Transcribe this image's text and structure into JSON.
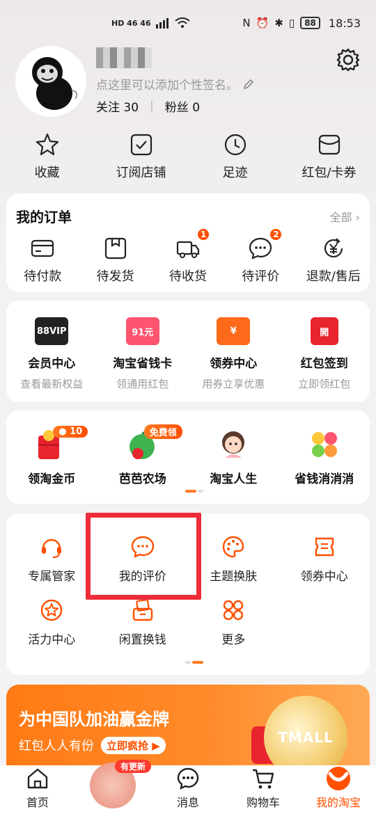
{
  "status_bar": {
    "network": "HD 46 46",
    "battery": "88",
    "time": "18:53"
  },
  "profile": {
    "signature_placeholder": "点这里可以添加个性签名。",
    "following_label": "关注",
    "following_count": "30",
    "followers_label": "粉丝",
    "followers_count": "0"
  },
  "quick_links": [
    {
      "label": "收藏",
      "icon": "star-icon"
    },
    {
      "label": "订阅店铺",
      "icon": "subscribe-icon"
    },
    {
      "label": "足迹",
      "icon": "clock-icon"
    },
    {
      "label": "红包/卡券",
      "icon": "coupon-icon"
    }
  ],
  "orders": {
    "title": "我的订单",
    "all_label": "全部 ›",
    "items": [
      {
        "label": "待付款",
        "badge": ""
      },
      {
        "label": "待发货",
        "badge": ""
      },
      {
        "label": "待收货",
        "badge": "1"
      },
      {
        "label": "待评价",
        "badge": "2"
      },
      {
        "label": "退款/售后",
        "badge": ""
      }
    ]
  },
  "vip_services": [
    {
      "icon_text": "88VIP",
      "title": "会员中心",
      "sub": "查看最新权益",
      "color": "#222222"
    },
    {
      "icon_text": "91元",
      "title": "淘宝省钱卡",
      "sub": "领通用红包",
      "color": "#ff5470"
    },
    {
      "icon_text": "¥",
      "title": "领券中心",
      "sub": "用券立享优惠",
      "color": "#ff6a1a"
    },
    {
      "icon_text": "開",
      "title": "红包签到",
      "sub": "立即领红包",
      "color": "#e8242f"
    }
  ],
  "games": [
    {
      "title": "领淘金币",
      "badge": "10"
    },
    {
      "title": "芭芭农场",
      "badge": "免费领"
    },
    {
      "title": "淘宝人生",
      "badge": ""
    },
    {
      "title": "省钱消消消",
      "badge": ""
    }
  ],
  "tools": [
    {
      "label": "专属管家",
      "icon": "headset-icon"
    },
    {
      "label": "我的评价",
      "icon": "comment-icon"
    },
    {
      "label": "主题换肤",
      "icon": "palette-icon"
    },
    {
      "label": "领券中心",
      "icon": "ticket-icon"
    },
    {
      "label": "活力中心",
      "icon": "star-badge-icon"
    },
    {
      "label": "闲置换钱",
      "icon": "idle-icon"
    },
    {
      "label": "更多",
      "icon": "grid-more-icon"
    }
  ],
  "banner": {
    "title": "为中国队加油赢金牌",
    "sub": "红包人人有份",
    "button": "立即疯抢",
    "coin_text": "TMALL"
  },
  "tabbar": [
    {
      "label": "首页",
      "active": false
    },
    {
      "label": "",
      "active": false,
      "badge": "有更新"
    },
    {
      "label": "消息",
      "active": false
    },
    {
      "label": "购物车",
      "active": false
    },
    {
      "label": "我的淘宝",
      "active": true
    }
  ],
  "colors": {
    "accent": "#ff5000",
    "highlight": "#ee2d3a"
  }
}
